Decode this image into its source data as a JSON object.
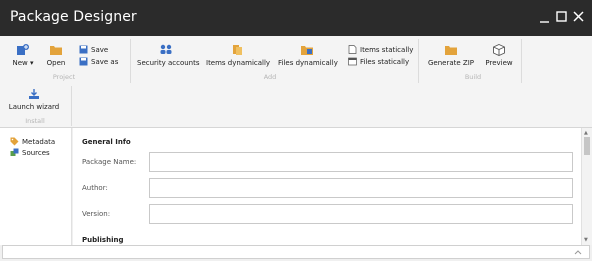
{
  "window": {
    "title": "Package Designer",
    "controls": {
      "minimize": "_",
      "maximize": "☐",
      "close": "✕"
    }
  },
  "ribbon": {
    "new_label": "New ▾",
    "open_label": "Open",
    "save_label": "Save",
    "save_as_label": "Save as",
    "group_project": "Project",
    "security_accounts_label": "Security accounts",
    "items_dynamically_label": "Items dynamically",
    "files_dynamically_label": "Files dynamically",
    "items_statically_label": "Items statically",
    "files_statically_label": "Files statically",
    "group_add": "Add",
    "generate_zip_label": "Generate ZIP",
    "preview_label": "Preview",
    "group_build": "Build",
    "launch_wizard_label": "Launch wizard",
    "group_install": "Install"
  },
  "nav": {
    "metadata": "Metadata",
    "sources": "Sources"
  },
  "form": {
    "general_info": "General Info",
    "package_name_label": "Package Name:",
    "package_name_value": "",
    "author_label": "Author:",
    "author_value": "",
    "version_label": "Version:",
    "version_value": "",
    "publishing": "Publishing"
  },
  "colors": {
    "titlebar": "#2b2b2b",
    "accent_blue": "#3a6fc4",
    "folder_orange": "#e3a33b"
  },
  "icons": {
    "new": "new-item-icon",
    "open": "folder-open-icon",
    "save": "floppy-icon",
    "save_as": "floppy-icon",
    "security_accounts": "users-icon",
    "items_dynamically": "items-icon",
    "files_dynamically": "folder-files-icon",
    "items_statically": "document-icon",
    "files_statically": "window-icon",
    "generate_zip": "folder-zip-icon",
    "preview": "cube-icon",
    "launch_wizard": "install-arrow-icon",
    "metadata": "tag-icon",
    "sources": "sources-icon",
    "footer": "chevron-up-icon"
  }
}
